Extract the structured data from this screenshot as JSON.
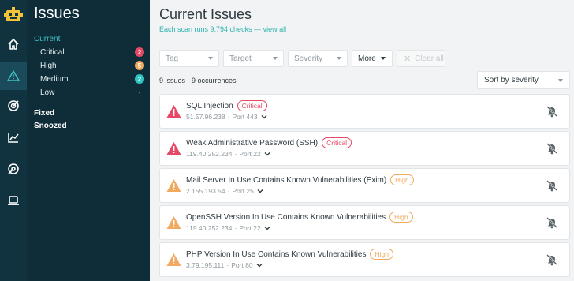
{
  "colors": {
    "rail_bg": "#11323f",
    "sidebar_bg": "#0f2d39",
    "accent_teal": "#2fb3b0",
    "critical": "#e74865",
    "high": "#f0a95e",
    "medium": "#2ec4c1"
  },
  "rail": {
    "logo": "robot-logo-icon",
    "items": [
      {
        "icon": "home-icon",
        "active": false
      },
      {
        "icon": "warning-icon",
        "active": true
      },
      {
        "icon": "target-icon",
        "active": false
      },
      {
        "icon": "chart-icon",
        "active": false
      },
      {
        "icon": "radar-icon",
        "active": false
      },
      {
        "icon": "laptop-icon",
        "active": false
      }
    ]
  },
  "sidebar": {
    "title": "Issues",
    "current_label": "Current",
    "items": [
      {
        "label": "Critical",
        "count": "2"
      },
      {
        "label": "High",
        "count": "5"
      },
      {
        "label": "Medium",
        "count": "2"
      },
      {
        "label": "Low",
        "count": "-"
      }
    ],
    "fixed_label": "Fixed",
    "snoozed_label": "Snoozed"
  },
  "main": {
    "title": "Current Issues",
    "subtitle_prefix": "Each scan runs 9,794 checks — ",
    "subtitle_link": "view all",
    "filters": {
      "tag": "Tag",
      "target": "Target",
      "severity": "Severity",
      "more": "More",
      "clear": "Clear all"
    },
    "summary": "9 issues · 9 occurrences",
    "sort": "Sort by severity",
    "issues": [
      {
        "name": "SQL Injection",
        "severity": "Critical",
        "ip": "51.57.96.238",
        "port": "Port 443"
      },
      {
        "name": "Weak Administrative Password (SSH)",
        "severity": "Critical",
        "ip": "119.40.252.234",
        "port": "Port 22"
      },
      {
        "name": "Mail Server In Use Contains Known Vulnerabilities (Exim)",
        "severity": "High",
        "ip": "2.155.193.54",
        "port": "Port 25"
      },
      {
        "name": "OpenSSH Version In Use Contains Known Vulnerabilities",
        "severity": "High",
        "ip": "119.40.252.234",
        "port": "Port 22"
      },
      {
        "name": "PHP Version In Use Contains Known Vulnerabilities",
        "severity": "High",
        "ip": "3.79.195.111",
        "port": "Port 80"
      }
    ]
  }
}
